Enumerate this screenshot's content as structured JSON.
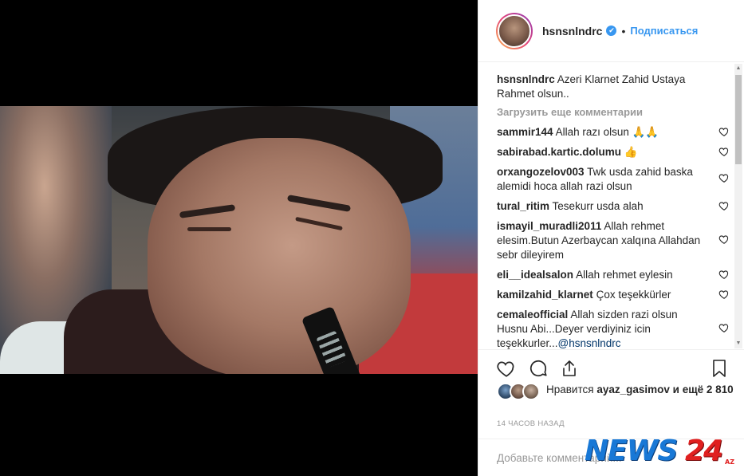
{
  "post": {
    "username": "hsnsnlndrc",
    "verified": true,
    "separator": "•",
    "follow_label": "Подписаться",
    "caption": "Azeri Klarnet Zahid Ustaya Rahmet olsun..",
    "load_more": "Загрузить еще комментарии",
    "comments": [
      {
        "user": "sammir144",
        "text": "Allah razı olsun 🙏🙏"
      },
      {
        "user": "sabirabad.kartic.dolumu",
        "text": "👍"
      },
      {
        "user": "orxangozelov003",
        "text": "Twk usda zahid baska alemidi hoca allah razi olsun"
      },
      {
        "user": "tural_ritim",
        "text": "Tesekurr usda alah"
      },
      {
        "user": "ismayil_muradli2011",
        "text": "Allah rehmet elesim.Butun Azerbaycan xalqına Allahdan sebr dileyirem"
      },
      {
        "user": "eli__idealsalon",
        "text": "Allah rehmet eylesin"
      },
      {
        "user": "kamilzahid_klarnet",
        "text": "Çox teşekkürler"
      },
      {
        "user": "cemaleofficial",
        "text": "Allah sizden razi olsun Husnu Abi...Deyer verdiyiniz icin teşekkurler...",
        "mention": "@hsnsnlndrc"
      }
    ],
    "likes": {
      "prefix": "Нравится",
      "user": "ayaz_gasimov",
      "suffix": "и ещё 2 810"
    },
    "timestamp": "14 часов назад",
    "add_comment_placeholder": "Добавьте комментарий..."
  },
  "watermark": {
    "news": "NEWS",
    "num": "24",
    "tld": "AZ"
  },
  "icons": {
    "like": "heart-icon",
    "comment": "comment-icon",
    "share": "share-icon",
    "save": "bookmark-icon",
    "verified": "verified-badge-icon"
  },
  "colors": {
    "link_blue": "#3897f0",
    "text": "#262626",
    "muted": "#999999",
    "watermark_blue": "#1878d6",
    "watermark_red": "#e02020"
  }
}
